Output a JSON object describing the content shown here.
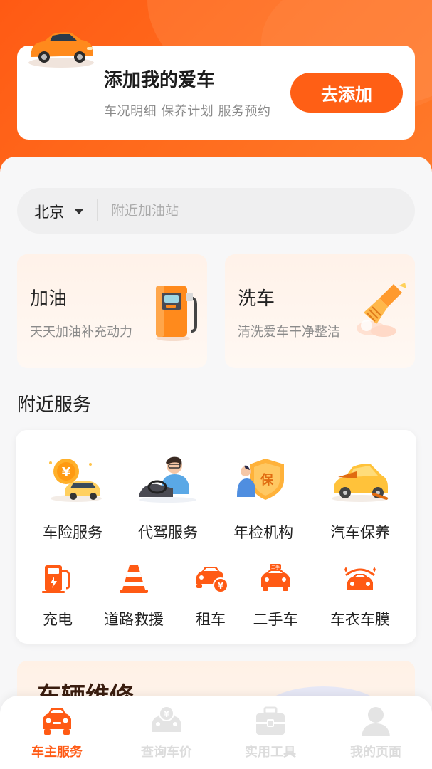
{
  "add_car": {
    "title": "添加我的爱车",
    "subtitle": "车况明细 保养计划 服务预约",
    "button_label": "去添加"
  },
  "search": {
    "city": "北京",
    "placeholder": "附近加油站"
  },
  "services": [
    {
      "title": "加油",
      "subtitle": "天天加油补充动力",
      "icon": "fuel-pump-icon"
    },
    {
      "title": "洗车",
      "subtitle": "清洗爱车干净整洁",
      "icon": "car-wash-brush-icon"
    }
  ],
  "nearby": {
    "title": "附近服务",
    "primary": [
      {
        "label": "车险服务",
        "icon": "car-insurance-icon"
      },
      {
        "label": "代驾服务",
        "icon": "designated-driver-icon"
      },
      {
        "label": "年检机构",
        "icon": "annual-inspection-icon"
      },
      {
        "label": "汽车保养",
        "icon": "car-maintenance-icon"
      }
    ],
    "secondary": [
      {
        "label": "充电",
        "icon": "charging-station-icon"
      },
      {
        "label": "道路救援",
        "icon": "traffic-cone-icon"
      },
      {
        "label": "租车",
        "icon": "car-rental-icon"
      },
      {
        "label": "二手车",
        "icon": "used-car-icon"
      },
      {
        "label": "车衣车膜",
        "icon": "car-film-icon"
      }
    ]
  },
  "repair": {
    "title": "车辆维修"
  },
  "tabbar": [
    {
      "label": "车主服务",
      "icon": "car-icon",
      "active": true
    },
    {
      "label": "查询车价",
      "icon": "price-query-icon",
      "active": false
    },
    {
      "label": "实用工具",
      "icon": "toolbox-icon",
      "active": false
    },
    {
      "label": "我的页面",
      "icon": "user-icon",
      "active": false
    }
  ],
  "colors": {
    "brand_orange": "#ff5a14",
    "button_orange": "#ff5f15",
    "inactive_tab": "#dcdcdc"
  }
}
